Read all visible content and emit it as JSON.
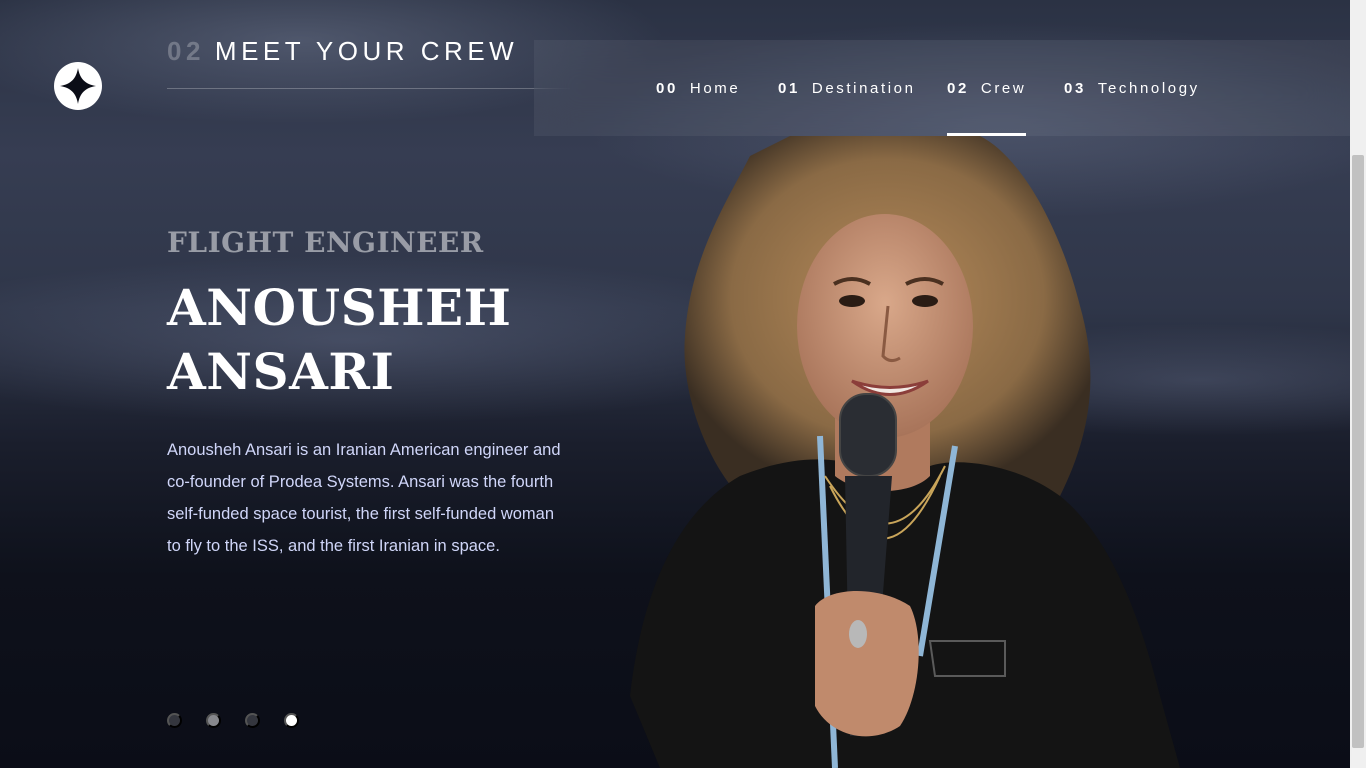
{
  "header": {
    "logo_icon": "four-point-star-icon",
    "page_number": "02",
    "page_title": "MEET YOUR CREW"
  },
  "nav": {
    "items": [
      {
        "number": "00",
        "label": "Home"
      },
      {
        "number": "01",
        "label": "Destination"
      },
      {
        "number": "02",
        "label": "Crew",
        "active": true
      },
      {
        "number": "03",
        "label": "Technology"
      }
    ]
  },
  "crew": {
    "role": "FLIGHT ENGINEER",
    "name_line1": "ANOUSHEH",
    "name_line2": "ANSARI",
    "bio": "Anousheh Ansari is an Iranian American engineer and co-founder of Prodea Systems. Ansari was the fourth self-funded space tourist, the first self-funded woman to fly to the ISS, and the first Iranian in space."
  },
  "slider": {
    "count": 4,
    "active_index": 3
  },
  "colors": {
    "background": "#0b0d17",
    "text_light": "#d0d6f9",
    "accent": "#ffffff"
  }
}
